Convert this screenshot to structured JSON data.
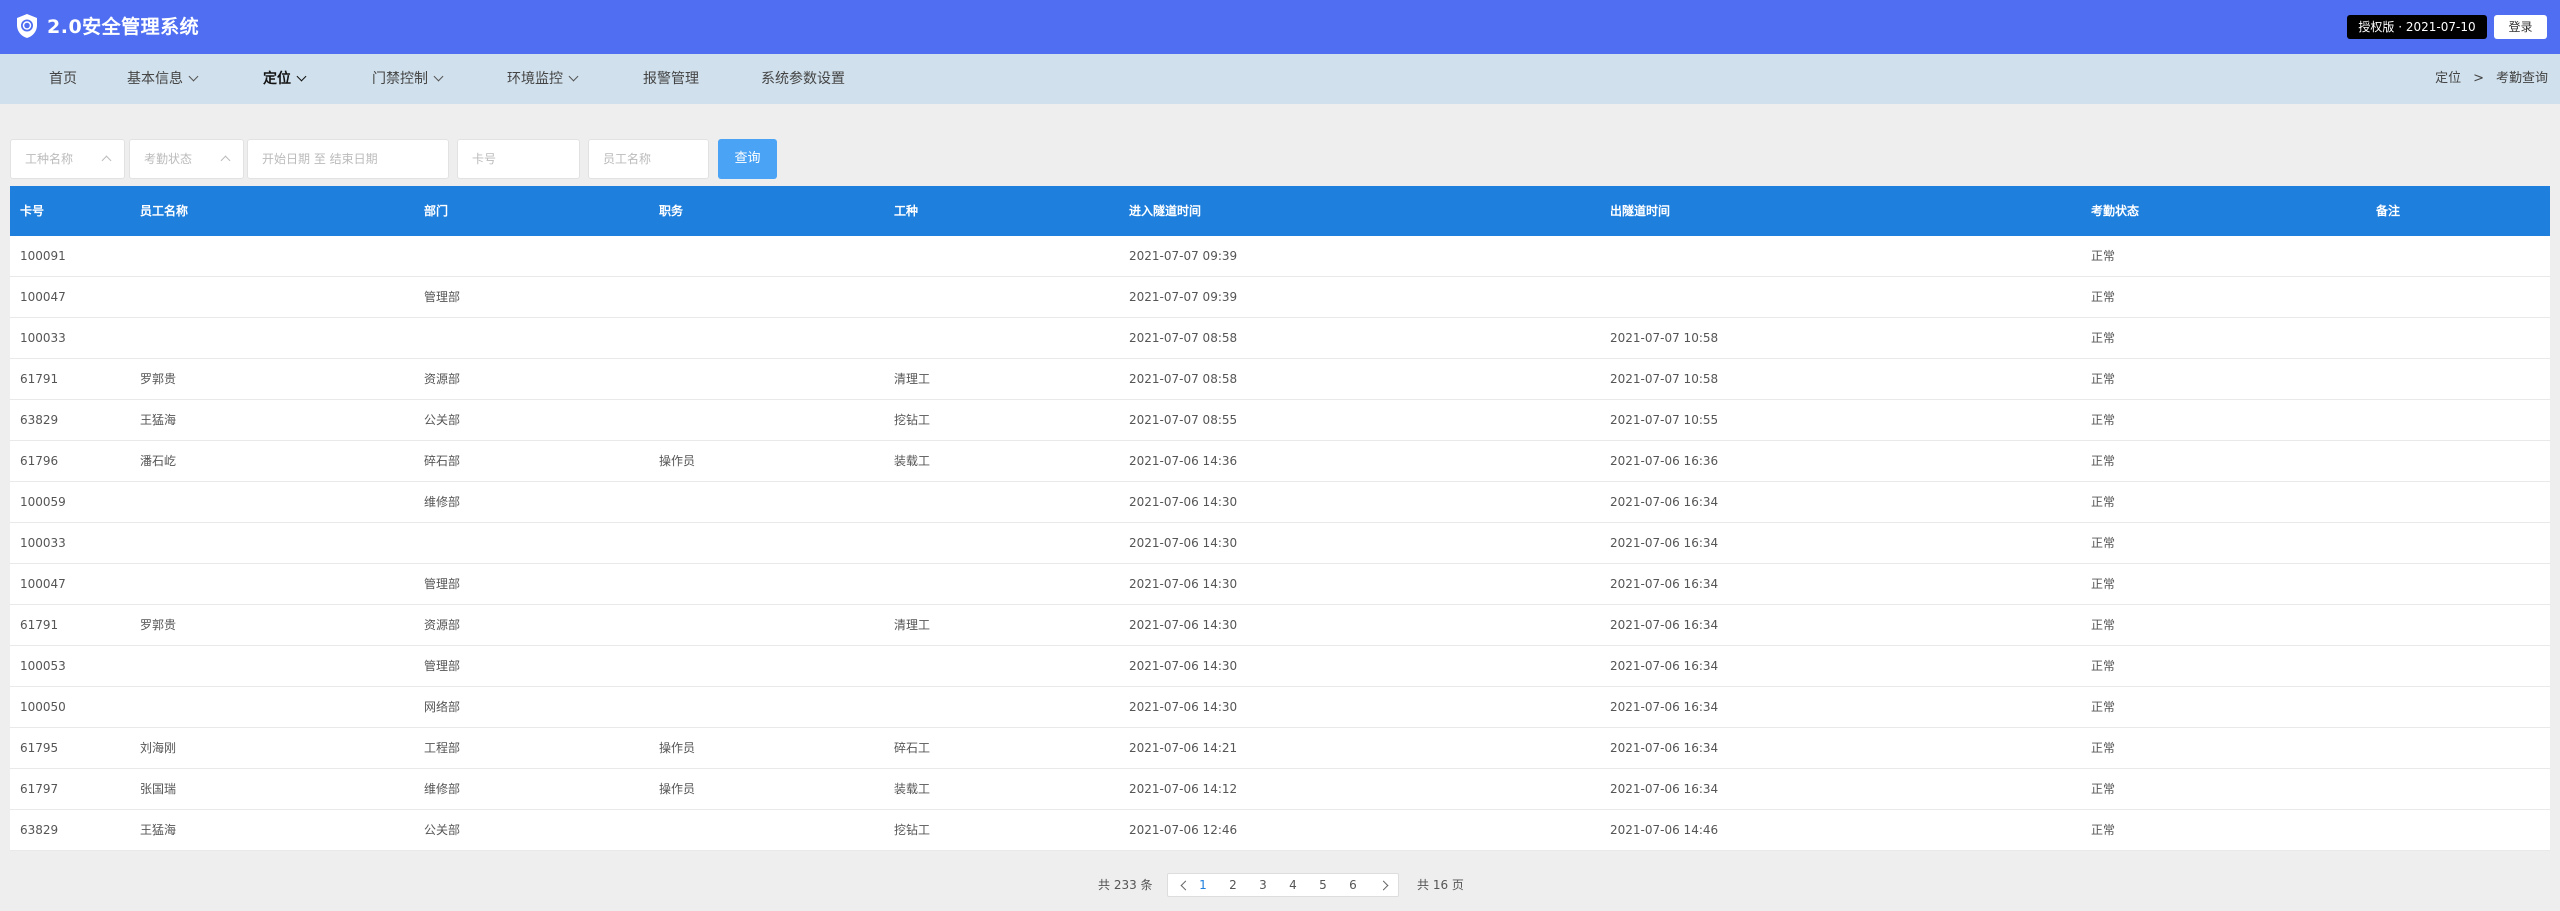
{
  "header": {
    "title": "2.0安全管理系统",
    "license": "授权版 · 2021-07-10",
    "login": "登录",
    "logo_icon": "shield-logo-icon"
  },
  "nav": {
    "items": [
      {
        "label": "首页",
        "dropdown": false
      },
      {
        "label": "基本信息",
        "dropdown": true
      },
      {
        "label": "定位",
        "dropdown": true,
        "active": true
      },
      {
        "label": "门禁控制",
        "dropdown": true
      },
      {
        "label": "环境监控",
        "dropdown": true
      },
      {
        "label": "报警管理",
        "dropdown": false
      },
      {
        "label": "系统参数设置",
        "dropdown": false
      }
    ],
    "breadcrumb": [
      "定位",
      ">",
      "考勤查询"
    ]
  },
  "filters": {
    "job_type": "工种名称",
    "attendance_status": "考勤状态",
    "date_range": "开始日期 至 结束日期",
    "card_no": "卡号",
    "employee_name": "员工名称",
    "query": "查询"
  },
  "table": {
    "columns": [
      "卡号",
      "员工名称",
      "部门",
      "职务",
      "工种",
      "进入隧道时间",
      "出隧道时间",
      "考勤状态",
      "备注"
    ],
    "rows": [
      [
        "100091",
        "",
        "",
        "",
        "",
        "2021-07-07 09:39",
        "",
        "正常",
        ""
      ],
      [
        "100047",
        "",
        "管理部",
        "",
        "",
        "2021-07-07 09:39",
        "",
        "正常",
        ""
      ],
      [
        "100033",
        "",
        "",
        "",
        "",
        "2021-07-07 08:58",
        "2021-07-07 10:58",
        "正常",
        ""
      ],
      [
        "61791",
        "罗郭贵",
        "资源部",
        "",
        "清理工",
        "2021-07-07 08:58",
        "2021-07-07 10:58",
        "正常",
        ""
      ],
      [
        "63829",
        "王猛海",
        "公关部",
        "",
        "挖钻工",
        "2021-07-07 08:55",
        "2021-07-07 10:55",
        "正常",
        ""
      ],
      [
        "61796",
        "潘石屹",
        "碎石部",
        "操作员",
        "装载工",
        "2021-07-06 14:36",
        "2021-07-06 16:36",
        "正常",
        ""
      ],
      [
        "100059",
        "",
        "维修部",
        "",
        "",
        "2021-07-06 14:30",
        "2021-07-06 16:34",
        "正常",
        ""
      ],
      [
        "100033",
        "",
        "",
        "",
        "",
        "2021-07-06 14:30",
        "2021-07-06 16:34",
        "正常",
        ""
      ],
      [
        "100047",
        "",
        "管理部",
        "",
        "",
        "2021-07-06 14:30",
        "2021-07-06 16:34",
        "正常",
        ""
      ],
      [
        "61791",
        "罗郭贵",
        "资源部",
        "",
        "清理工",
        "2021-07-06 14:30",
        "2021-07-06 16:34",
        "正常",
        ""
      ],
      [
        "100053",
        "",
        "管理部",
        "",
        "",
        "2021-07-06 14:30",
        "2021-07-06 16:34",
        "正常",
        ""
      ],
      [
        "100050",
        "",
        "网络部",
        "",
        "",
        "2021-07-06 14:30",
        "2021-07-06 16:34",
        "正常",
        ""
      ],
      [
        "61795",
        "刘海刚",
        "工程部",
        "操作员",
        "碎石工",
        "2021-07-06 14:21",
        "2021-07-06 16:34",
        "正常",
        ""
      ],
      [
        "61797",
        "张国瑞",
        "维修部",
        "操作员",
        "装载工",
        "2021-07-06 14:12",
        "2021-07-06 16:34",
        "正常",
        ""
      ],
      [
        "63829",
        "王猛海",
        "公关部",
        "",
        "挖钻工",
        "2021-07-06 12:46",
        "2021-07-06 14:46",
        "正常",
        ""
      ]
    ]
  },
  "pagination": {
    "total": "共 233 条",
    "pages": [
      "1",
      "2",
      "3",
      "4",
      "5",
      "6"
    ],
    "current": "1",
    "total_pages": "共 16 页"
  },
  "colors": {
    "header": "#4f6ef2",
    "nav": "#d0e0ec",
    "table_header": "#1e7fdc",
    "query_button": "#4aa3f5"
  }
}
